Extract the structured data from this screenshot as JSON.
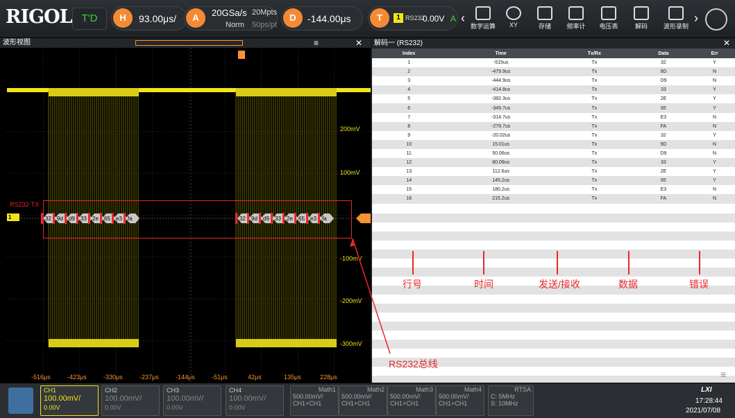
{
  "brand": "RIGOL",
  "topbar": {
    "mode": "T'D",
    "h_label": "H",
    "timebase": "93.00μs/",
    "a_label": "A",
    "sample_rate": "20GSa/s",
    "acq_mode": "Norm",
    "mem_depth": "20Mpts",
    "mem_sub": "50ps/pt",
    "d_label": "D",
    "delay": "-144.00μs",
    "t_label": "T",
    "trig_src": "1",
    "trig_type": "RS232",
    "trig_level": "0.00V",
    "trig_a": "A",
    "buttons": [
      {
        "label": "数学运算"
      },
      {
        "label": "XY"
      },
      {
        "label": "存储"
      },
      {
        "label": "频率计"
      },
      {
        "label": "电压表"
      },
      {
        "label": "解码"
      },
      {
        "label": "波形录制"
      }
    ]
  },
  "wave": {
    "title": "波形视图",
    "bus_label": "RS232-TX",
    "ch_marker": "1",
    "volt_labels": [
      "200mV",
      "100mV",
      "-100mV",
      "-200mV",
      "-300mV"
    ],
    "time_labels": [
      "-516μs",
      "-423μs",
      "-330μs",
      "-237μs",
      "-144μs",
      "-51μs",
      "42μs",
      "135μs",
      "228μs"
    ],
    "bytes_a": [
      "32",
      "9d",
      "d9",
      "33",
      "2e",
      "65",
      "e3",
      "fa"
    ],
    "bytes_b": [
      "32",
      "9d",
      "d9",
      "33",
      "2e",
      "65",
      "e3",
      "fa"
    ],
    "bus_annotation": "RS232总线"
  },
  "decode": {
    "title": "解码一 (RS232)",
    "columns": [
      "Index",
      "Time",
      "Tx/Rx",
      "Data",
      "Err"
    ],
    "rows": [
      [
        "1",
        "-515us",
        "Tx",
        "32",
        "Y"
      ],
      [
        "2",
        "-479.9us",
        "Tx",
        "9D",
        "N"
      ],
      [
        "3",
        "-444.9us",
        "Tx",
        "D9",
        "N"
      ],
      [
        "4",
        "-414.8us",
        "Tx",
        "33",
        "Y"
      ],
      [
        "5",
        "-382.3us",
        "Tx",
        "2E",
        "Y"
      ],
      [
        "6",
        "-349.7us",
        "Tx",
        "65",
        "Y"
      ],
      [
        "7",
        "-314.7us",
        "Tx",
        "E3",
        "N"
      ],
      [
        "8",
        "-279.7us",
        "Tx",
        "FA",
        "N"
      ],
      [
        "9",
        "-20.02us",
        "Tx",
        "32",
        "Y"
      ],
      [
        "10",
        "15.01us",
        "Tx",
        "9D",
        "N"
      ],
      [
        "11",
        "50.06us",
        "Tx",
        "D9",
        "N"
      ],
      [
        "12",
        "80.09us",
        "Tx",
        "33",
        "Y"
      ],
      [
        "13",
        "112.6us",
        "Tx",
        "2E",
        "Y"
      ],
      [
        "14",
        "145.2us",
        "Tx",
        "65",
        "Y"
      ],
      [
        "15",
        "180.2us",
        "Tx",
        "E3",
        "N"
      ],
      [
        "16",
        "215.2us",
        "Tx",
        "FA",
        "N"
      ]
    ],
    "annotations": [
      "行号",
      "时间",
      "发送/接收",
      "数据",
      "错误"
    ]
  },
  "channels": [
    {
      "name": "CH1",
      "scale": "100.00mV/",
      "offset": "0.00V"
    },
    {
      "name": "CH2",
      "scale": "100.00mV/",
      "offset": "0.00V"
    },
    {
      "name": "CH3",
      "scale": "100.00mV/",
      "offset": "0.00V"
    },
    {
      "name": "CH4",
      "scale": "100.00mV/",
      "offset": "0.00V"
    }
  ],
  "maths": [
    {
      "name": "Math1",
      "scale": "500.00mV/",
      "src": "CH1+CH1"
    },
    {
      "name": "Math2",
      "scale": "500.00mV/",
      "src": "CH1+CH1"
    },
    {
      "name": "Math3",
      "scale": "500.00mV/",
      "src": "CH1+CH1"
    },
    {
      "name": "Math4",
      "scale": "500.00mV/",
      "src": "CH1+CH1"
    }
  ],
  "rtsa": {
    "name": "RTSA",
    "center": "C: 5MHz",
    "span": "S: 10MHz"
  },
  "status": {
    "lxi": "LXI",
    "time": "17:28:44",
    "date": "2021/07/08"
  },
  "colors": {
    "ch1": "#f2e51b",
    "decode_red": "#e8292a",
    "trigger_orange": "#f79431"
  }
}
